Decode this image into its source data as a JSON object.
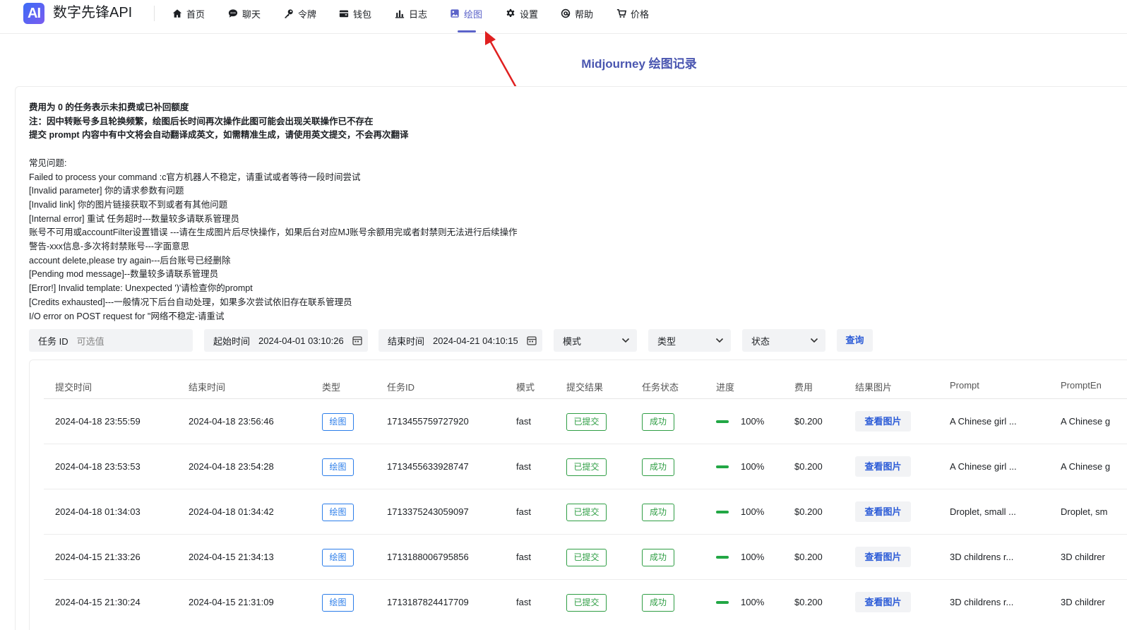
{
  "brand": {
    "logo_text": "AI",
    "name": "数字先锋API"
  },
  "nav": [
    {
      "label": "首页",
      "icon": "home-icon"
    },
    {
      "label": "聊天",
      "icon": "chat-icon"
    },
    {
      "label": "令牌",
      "icon": "key-icon"
    },
    {
      "label": "钱包",
      "icon": "wallet-icon"
    },
    {
      "label": "日志",
      "icon": "chart-icon"
    },
    {
      "label": "绘图",
      "icon": "image-icon",
      "active": true
    },
    {
      "label": "设置",
      "icon": "gear-icon"
    },
    {
      "label": "帮助",
      "icon": "at-icon"
    },
    {
      "label": "价格",
      "icon": "price-icon"
    }
  ],
  "page_title": "Midjourney 绘图记录",
  "notes": {
    "bold": [
      "费用为 0 的任务表示未扣费或已补回额度",
      "注：因中转账号多且轮换频繁，绘图后长时间再次操作此图可能会出现关联操作已不存在",
      "提交 prompt 内容中有中文将会自动翻译成英文，如需精准生成，请使用英文提交，不会再次翻译"
    ],
    "faq_title": "常见问题:",
    "faq": [
      "Failed to process your command :c官方机器人不稳定，请重试或者等待一段时间尝试",
      "[Invalid parameter] 你的请求参数有问题",
      "[Invalid link] 你的图片链接获取不到或者有其他问题",
      "[Internal error] 重试 任务超时---数量较多请联系管理员",
      "账号不可用或accountFilter设置错误 ---请在生成图片后尽快操作，如果后台对应MJ账号余额用完或者封禁则无法进行后续操作",
      "警告-xxx信息-多次将封禁账号---字面意思",
      "account delete,please try again---后台账号已经删除",
      "[Pending mod message]--数量较多请联系管理员",
      "[Error!] Invalid template: Unexpected ')'请检查你的prompt",
      "[Credits exhausted]---一般情况下后台自动处理，如果多次尝试依旧存在联系管理员",
      "I/O error on POST request for \"网络不稳定-请重试"
    ]
  },
  "filters": {
    "task_id": {
      "label": "任务 ID",
      "placeholder": "可选值"
    },
    "start_time": {
      "label": "起始时间",
      "value": "2024-04-01 03:10:26"
    },
    "end_time": {
      "label": "结束时间",
      "value": "2024-04-21 04:10:15"
    },
    "mode": "模式",
    "type": "类型",
    "status": "状态",
    "query_button": "查询"
  },
  "table": {
    "columns": [
      "提交时间",
      "结束时间",
      "类型",
      "任务ID",
      "模式",
      "提交结果",
      "任务状态",
      "进度",
      "费用",
      "结果图片",
      "Prompt",
      "PromptEn"
    ],
    "rows": [
      {
        "submit": "2024-04-18 23:55:59",
        "end": "2024-04-18 23:56:46",
        "type": "绘图",
        "id": "1713455759727920",
        "mode": "fast",
        "result": "已提交",
        "status": "成功",
        "progress": 100,
        "progress_text": "100%",
        "cost": "$0.200",
        "view": "查看图片",
        "prompt": "A Chinese girl ...",
        "prompt_en": "A Chinese g"
      },
      {
        "submit": "2024-04-18 23:53:53",
        "end": "2024-04-18 23:54:28",
        "type": "绘图",
        "id": "1713455633928747",
        "mode": "fast",
        "result": "已提交",
        "status": "成功",
        "progress": 100,
        "progress_text": "100%",
        "cost": "$0.200",
        "view": "查看图片",
        "prompt": "A Chinese girl ...",
        "prompt_en": "A Chinese g"
      },
      {
        "submit": "2024-04-18 01:34:03",
        "end": "2024-04-18 01:34:42",
        "type": "绘图",
        "id": "1713375243059097",
        "mode": "fast",
        "result": "已提交",
        "status": "成功",
        "progress": 100,
        "progress_text": "100%",
        "cost": "$0.200",
        "view": "查看图片",
        "prompt": "Droplet, small ...",
        "prompt_en": "Droplet, sm"
      },
      {
        "submit": "2024-04-15 21:33:26",
        "end": "2024-04-15 21:34:13",
        "type": "绘图",
        "id": "1713188006795856",
        "mode": "fast",
        "result": "已提交",
        "status": "成功",
        "progress": 100,
        "progress_text": "100%",
        "cost": "$0.200",
        "view": "查看图片",
        "prompt": "3D childrens r...",
        "prompt_en": "3D childrer"
      },
      {
        "submit": "2024-04-15 21:30:24",
        "end": "2024-04-15 21:31:09",
        "type": "绘图",
        "id": "1713187824417709",
        "mode": "fast",
        "result": "已提交",
        "status": "成功",
        "progress": 100,
        "progress_text": "100%",
        "cost": "$0.200",
        "view": "查看图片",
        "prompt": "3D childrens r...",
        "prompt_en": "3D childrer"
      }
    ]
  },
  "colors": {
    "accent": "#5b63c9",
    "link": "#2b5bd7",
    "tag_blue": "#2b7de9",
    "success": "#2f9e44",
    "annotation": "#e02020"
  }
}
